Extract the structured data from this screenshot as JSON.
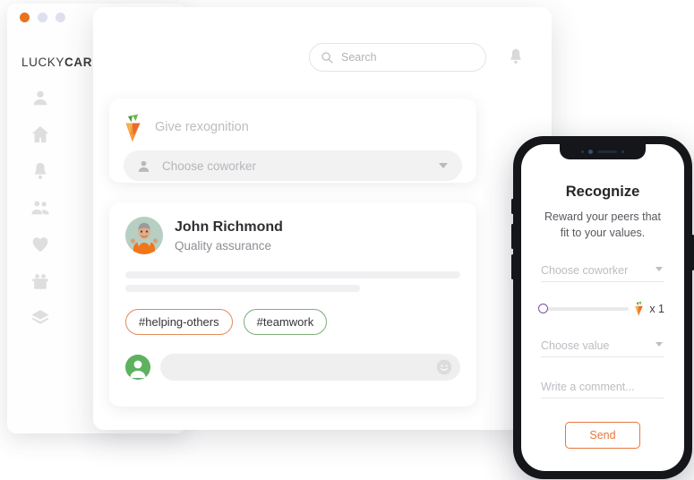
{
  "window": {
    "dots": [
      {
        "name": "close-dot",
        "color": "#E8731E"
      },
      {
        "name": "minimize-dot",
        "color": "#DEE0F0"
      },
      {
        "name": "maximize-dot",
        "color": "#DEE0F0"
      }
    ]
  },
  "brand": {
    "name_light": "LUCKY",
    "name_bold": "CARROT",
    "logo_icon": "carrot-icon",
    "accent_orange": "#E8731E",
    "accent_green": "#7CAE7A",
    "accent_purple": "#7B4FA8"
  },
  "sidebar": {
    "items": [
      {
        "icon": "person-icon",
        "label": "Profile"
      },
      {
        "icon": "home-icon",
        "label": "Home"
      },
      {
        "icon": "bell-icon",
        "label": "Notifications"
      },
      {
        "icon": "people-icon",
        "label": "Team"
      },
      {
        "icon": "heart-icon",
        "label": "Favorites"
      },
      {
        "icon": "gift-icon",
        "label": "Rewards"
      },
      {
        "icon": "layers-icon",
        "label": "Catalog"
      }
    ]
  },
  "header": {
    "search": {
      "icon": "search-icon",
      "placeholder": "Search",
      "value": ""
    },
    "notification_icon": "bell-icon"
  },
  "composer": {
    "icon": "carrot-icon",
    "message_placeholder": "Give rexognition",
    "message_value": "",
    "coworker_icon": "person-icon",
    "coworker_placeholder": "Choose coworker",
    "coworker_value": "",
    "dropdown_icon": "chevron-down-icon"
  },
  "post": {
    "avatar": "user-photo-avatar",
    "name": "John Richmond",
    "role": "Quality assurance",
    "body_skeleton_lines": 2,
    "tags": [
      {
        "label": "#helping-others",
        "border_color": "#E28B5A"
      },
      {
        "label": "#teamwork",
        "border_color": "#7CAE7A"
      }
    ],
    "comment": {
      "avatar": "person-avatar",
      "placeholder": "",
      "value": "",
      "emoji_icon": "smiley-icon"
    }
  },
  "phone": {
    "title": "Recognize",
    "subtitle": "Reward your peers that fit to your values.",
    "coworker_placeholder": "Choose coworker",
    "coworker_value": "",
    "slider": {
      "value": 1,
      "min": 1,
      "max": 10,
      "position_percent": 0,
      "carrot_icon": "carrot-icon",
      "count_label": "x 1"
    },
    "value_placeholder": "Choose value",
    "value_selected": "",
    "comment_placeholder": "Write a comment...",
    "comment_value": "",
    "send_label": "Send"
  }
}
